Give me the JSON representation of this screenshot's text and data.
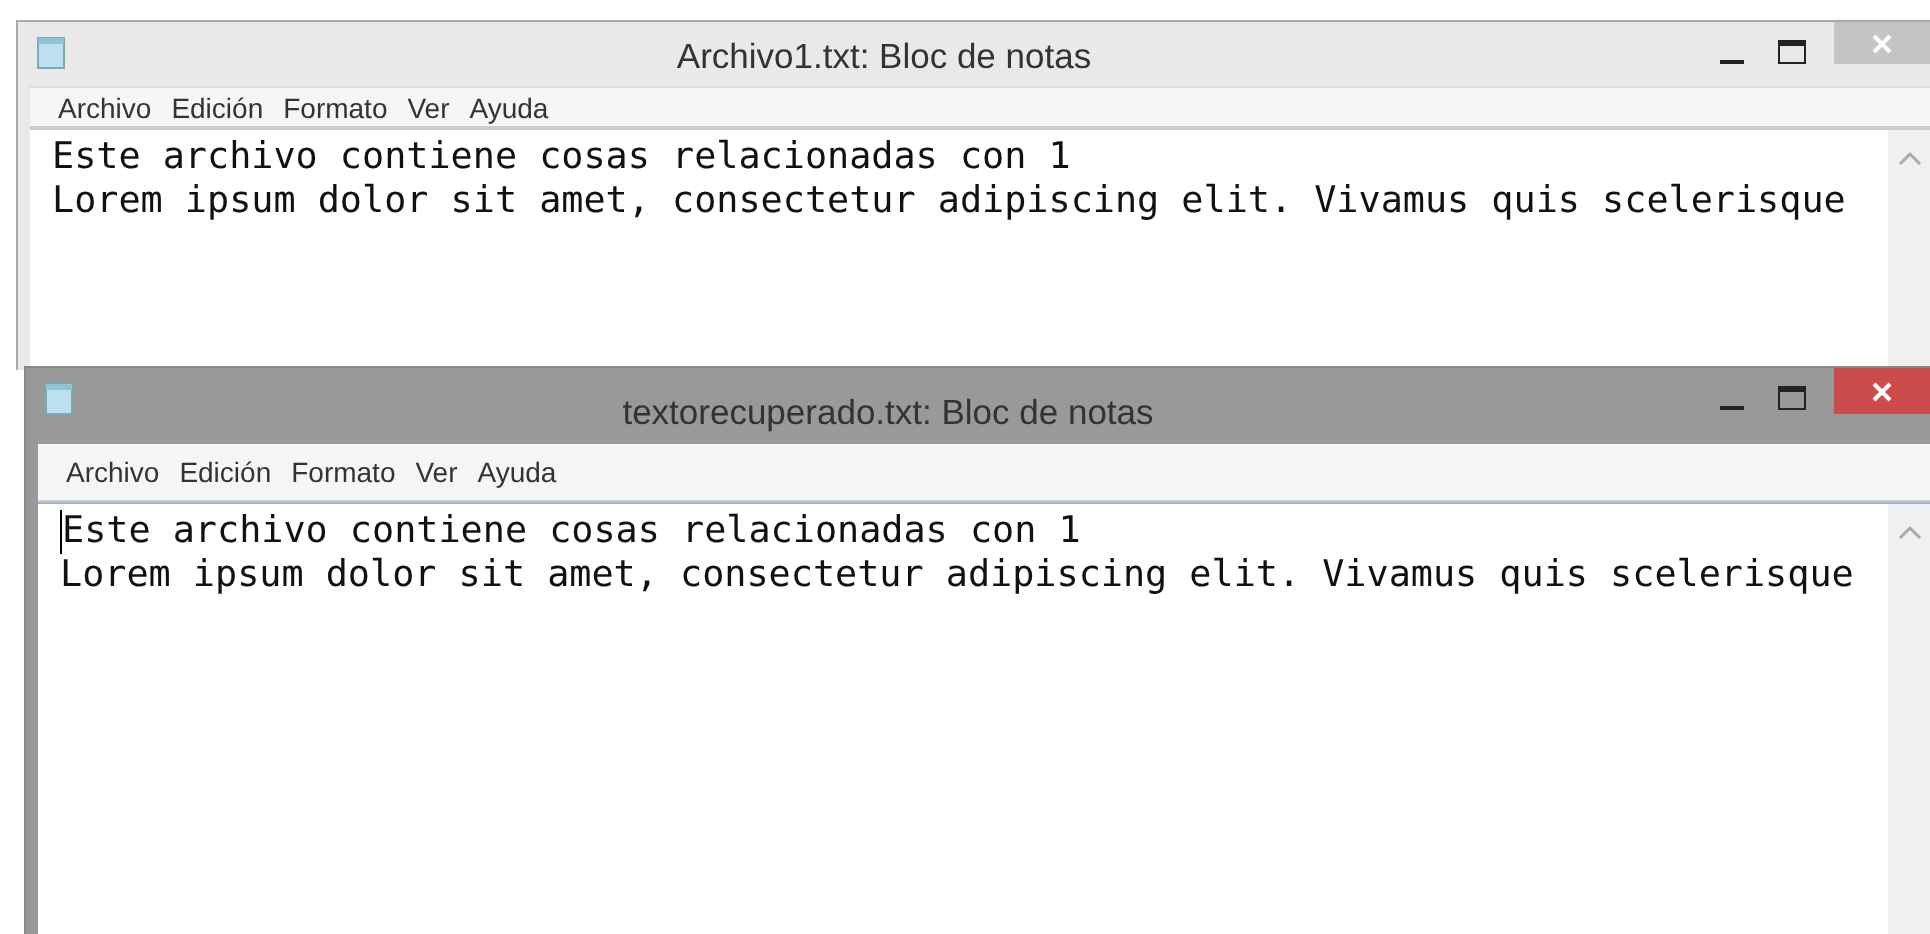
{
  "windows": [
    {
      "title": "Archivo1.txt: Bloc de notas",
      "active": false,
      "menu": [
        "Archivo",
        "Edición",
        "Formato",
        "Ver",
        "Ayuda"
      ],
      "lines": [
        "Este archivo contiene cosas relacionadas con 1",
        "Lorem ipsum dolor sit amet, consectetur adipiscing elit. Vivamus quis scelerisque"
      ]
    },
    {
      "title": "textorecuperado.txt: Bloc de notas",
      "active": true,
      "menu": [
        "Archivo",
        "Edición",
        "Formato",
        "Ver",
        "Ayuda"
      ],
      "lines": [
        "Este archivo contiene cosas relacionadas con 1",
        "Lorem ipsum dolor sit amet, consectetur adipiscing elit. Vivamus quis scelerisque"
      ]
    }
  ]
}
